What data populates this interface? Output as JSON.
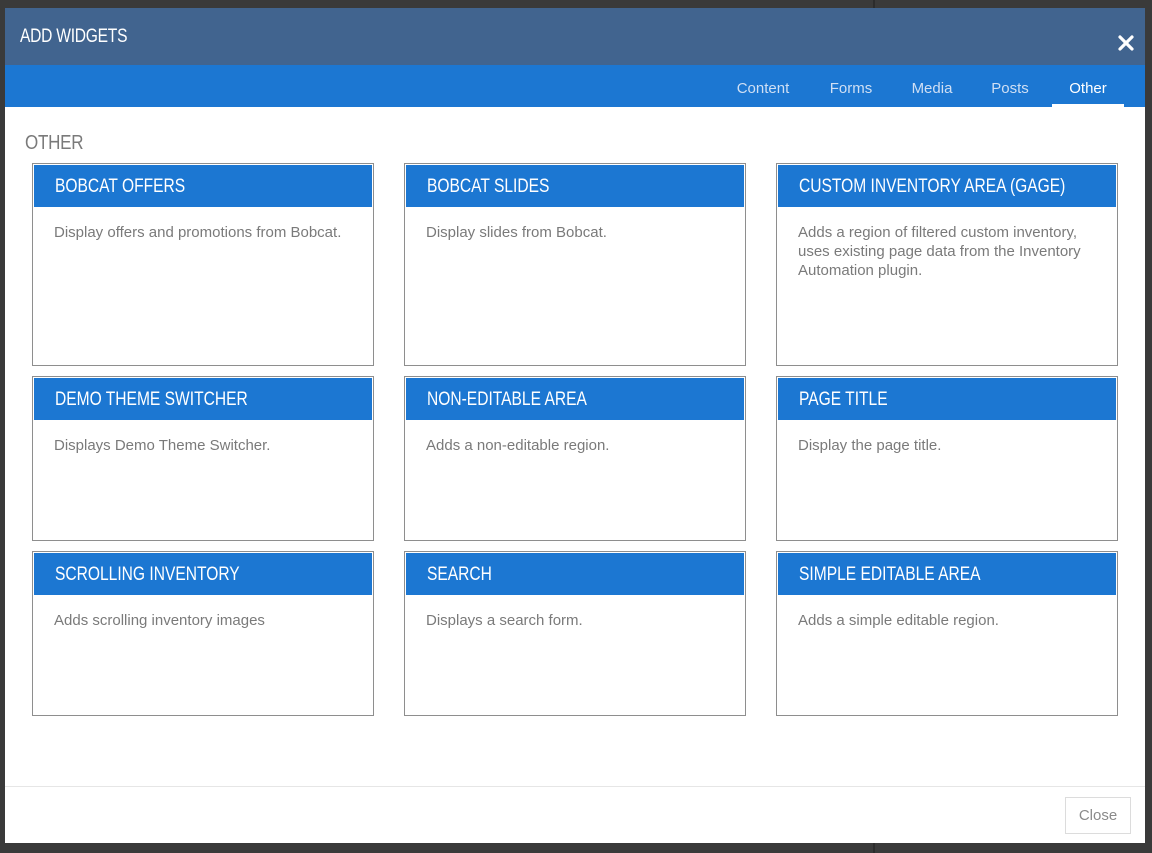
{
  "modal": {
    "title": "ADD WIDGETS",
    "close_icon": "close-icon"
  },
  "tabs": [
    {
      "label": "Content",
      "active": false
    },
    {
      "label": "Forms",
      "active": false
    },
    {
      "label": "Media",
      "active": false
    },
    {
      "label": "Posts",
      "active": false
    },
    {
      "label": "Other",
      "active": true
    }
  ],
  "section": {
    "title": "OTHER"
  },
  "widgets": [
    {
      "title": "BOBCAT OFFERS",
      "description": "Display offers and promotions from Bobcat."
    },
    {
      "title": "BOBCAT SLIDES",
      "description": "Display slides from Bobcat."
    },
    {
      "title": "CUSTOM INVENTORY AREA (GAGE)",
      "description": "Adds a region of filtered custom inventory, uses existing page data from the Inventory Automation plugin."
    },
    {
      "title": "DEMO THEME SWITCHER",
      "description": "Displays Demo Theme Switcher."
    },
    {
      "title": "NON-EDITABLE AREA",
      "description": "Adds a non-editable region."
    },
    {
      "title": "PAGE TITLE",
      "description": "Display the page title."
    },
    {
      "title": "SCROLLING INVENTORY",
      "description": "Adds scrolling inventory images"
    },
    {
      "title": "SEARCH",
      "description": "Displays a search form."
    },
    {
      "title": "SIMPLE EDITABLE AREA",
      "description": "Adds a simple editable region."
    }
  ],
  "footer": {
    "close_label": "Close"
  },
  "colors": {
    "header": "#41648f",
    "tabbar": "#1c77d2",
    "card_header": "#1c77d2"
  }
}
